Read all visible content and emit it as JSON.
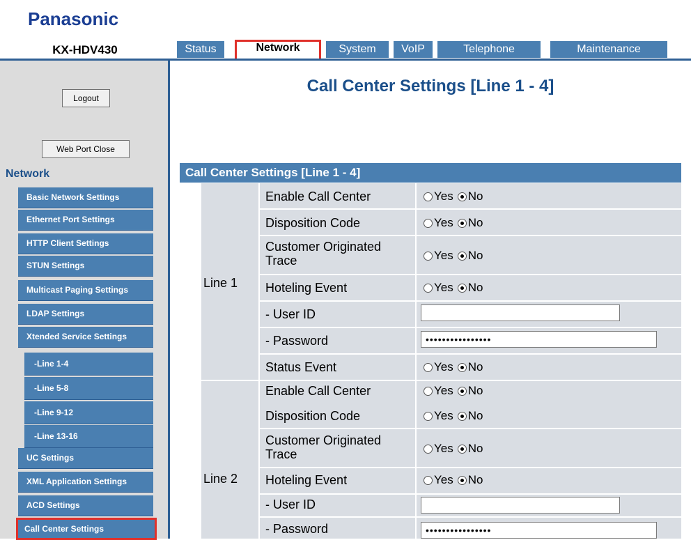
{
  "brand": "Panasonic",
  "model": "KX-HDV430",
  "tabs": [
    "Status",
    "Network",
    "System",
    "VoIP",
    "Telephone",
    "Maintenance"
  ],
  "buttons": {
    "logout": "Logout",
    "web_port_close": "Web Port Close"
  },
  "sidebar": {
    "title": "Network",
    "items": [
      "Basic Network Settings",
      "Ethernet Port Settings",
      "HTTP Client Settings",
      "STUN Settings",
      "Multicast Paging Settings",
      "LDAP Settings",
      "Xtended Service Settings",
      "-Line 1-4",
      "-Line 5-8",
      "-Line 9-12",
      "-Line 13-16",
      "UC Settings",
      "XML Application Settings",
      "ACD Settings",
      "Call Center Settings"
    ]
  },
  "page_title": "Call Center Settings [Line 1 - 4]",
  "section_title": "Call Center Settings [Line 1 - 4]",
  "radio": {
    "yes": "Yes",
    "no": "No"
  },
  "lines": [
    {
      "name": "Line 1",
      "fields": {
        "enable_call_center": "Enable Call Center",
        "disposition_code": "Disposition Code",
        "customer_originated_trace": "Customer Originated Trace",
        "hoteling_event": "Hoteling Event",
        "user_id": "- User ID",
        "password": "- Password",
        "status_event": "Status Event"
      },
      "user_id_value": "",
      "password_value": "••••••••••••••••"
    },
    {
      "name": "Line 2",
      "fields": {
        "enable_call_center": "Enable Call Center",
        "disposition_code": "Disposition Code",
        "customer_originated_trace": "Customer Originated Trace",
        "hoteling_event": "Hoteling Event",
        "user_id": "- User ID",
        "password": "- Password"
      },
      "user_id_value": "",
      "password_value": "••••••••••••••••"
    }
  ]
}
